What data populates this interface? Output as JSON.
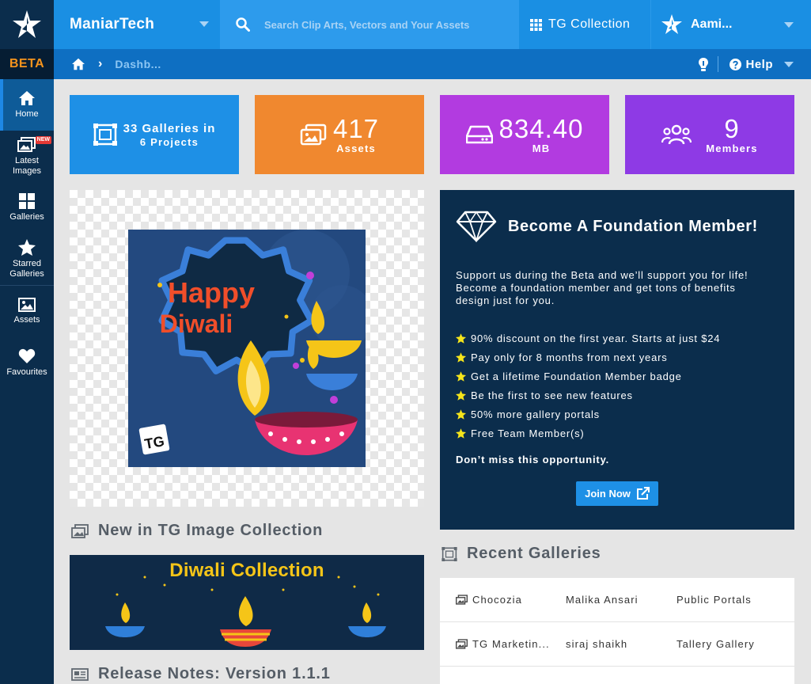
{
  "app": {
    "beta_label": "BETA"
  },
  "sidebar": {
    "items": [
      {
        "label": "Home",
        "icon": "home-icon",
        "active": true
      },
      {
        "label": "Latest Images",
        "icon": "images-icon",
        "badge": "NEW"
      },
      {
        "label": "Galleries",
        "icon": "grid-icon"
      },
      {
        "label": "Starred Galleries",
        "icon": "star-icon"
      },
      {
        "label": "Assets",
        "icon": "image-icon"
      },
      {
        "label": "Favourites",
        "icon": "heart-icon"
      }
    ]
  },
  "topbar": {
    "workspace": "ManiarTech",
    "search_placeholder": "Search Clip Arts, Vectors and Your Assets",
    "collection": "TG Collection",
    "user": "Aami..."
  },
  "breadcrumb": {
    "current": "Dashb...",
    "help": "Help"
  },
  "stats": {
    "galleries": {
      "line1": "33 Galleries in",
      "line2": "6 Projects"
    },
    "assets": {
      "value": "417",
      "label": "Assets"
    },
    "storage": {
      "value": "834.40",
      "label": "MB"
    },
    "members": {
      "value": "9",
      "label": "Members"
    }
  },
  "featured": {
    "line1": "Happy",
    "line2": "Diwali",
    "watermark": "TG"
  },
  "new_collection": {
    "title": "New in TG Image Collection",
    "banner_title": "Diwali Collection"
  },
  "release_notes": {
    "title": "Release Notes: Version 1.1.1"
  },
  "foundation": {
    "title": "Become A Foundation Member!",
    "description": "Support us during the Beta and we’ll support you for life! Become a foundation member and get tons of benefits design just for you.",
    "benefits": [
      "90% discount on the first year. Starts at just $24",
      "Pay only for 8 months from next years",
      "Get a lifetime Foundation Member badge",
      "Be the first to see new features",
      "50% more gallery portals",
      "Free Team Member(s)"
    ],
    "closing": "Don’t miss this opportunity.",
    "cta": "Join Now"
  },
  "recent_galleries": {
    "title": "Recent Galleries",
    "rows": [
      {
        "name": "Chocozia",
        "owner": "Malika Ansari",
        "type": "Public Portals"
      },
      {
        "name": "TG Marketin...",
        "owner": "siraj shaikh",
        "type": "Tallery Gallery"
      }
    ]
  },
  "colors": {
    "accent": "#1a8fe3",
    "sidebar": "#0b2d4c",
    "orange": "#f0882f",
    "purple": "#b23be0",
    "violet": "#8e3ae5",
    "beta": "#f7941d"
  }
}
